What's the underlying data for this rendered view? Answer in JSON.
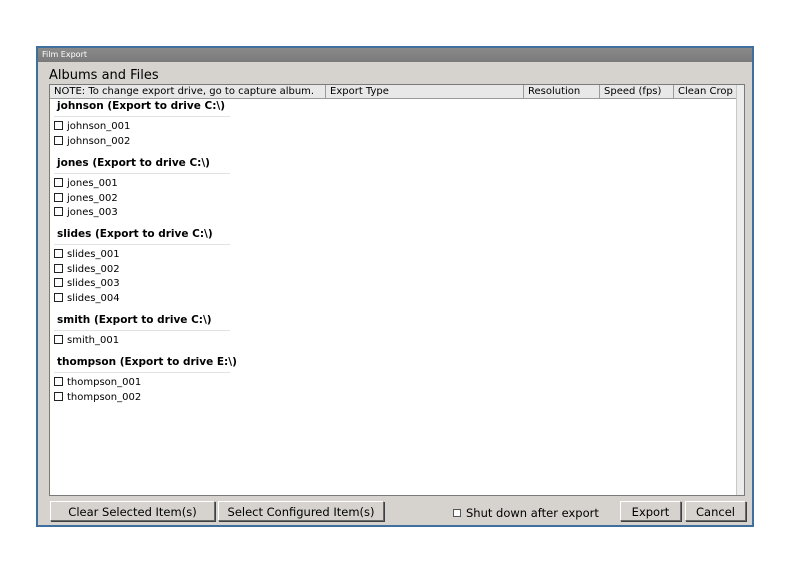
{
  "window": {
    "title": "Film Export"
  },
  "section_title": "Albums and Files",
  "columns": [
    {
      "label": "NOTE: To change export drive, go to capture album."
    },
    {
      "label": "Export Type"
    },
    {
      "label": "Resolution"
    },
    {
      "label": "Speed (fps)"
    },
    {
      "label": "Clean Crop"
    }
  ],
  "groups": [
    {
      "header": "johnson (Export to drive C:\\)",
      "items": [
        "johnson_001",
        "johnson_002"
      ]
    },
    {
      "header": "jones (Export to drive C:\\)",
      "items": [
        "jones_001",
        "jones_002",
        "jones_003"
      ]
    },
    {
      "header": "slides (Export to drive C:\\)",
      "items": [
        "slides_001",
        "slides_002",
        "slides_003",
        "slides_004"
      ]
    },
    {
      "header": "smith (Export to drive C:\\)",
      "items": [
        "smith_001"
      ]
    },
    {
      "header": "thompson (Export to drive E:\\)",
      "items": [
        "thompson_001",
        "thompson_002"
      ]
    }
  ],
  "buttons": {
    "clear": "Clear Selected Item(s)",
    "select_configured": "Select Configured Item(s)",
    "export": "Export",
    "cancel": "Cancel"
  },
  "shutdown": {
    "label": "Shut down after export",
    "checked": false
  }
}
